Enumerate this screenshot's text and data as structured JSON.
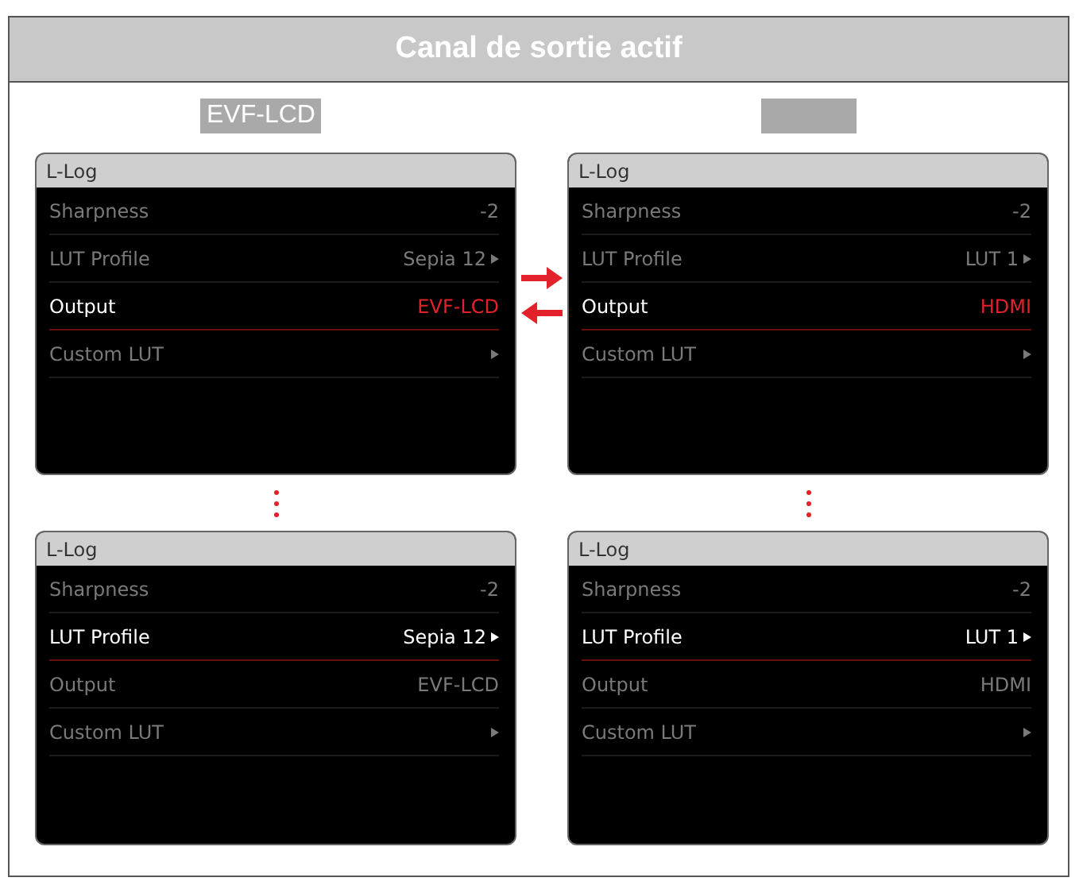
{
  "title": "Canal de sortie actif",
  "columns": [
    {
      "chip": "EVF-LCD",
      "screens": [
        {
          "header": "L-Log",
          "rows": [
            {
              "label": "Sharpness",
              "value": "-2",
              "selected": false,
              "value_highlighted": false
            },
            {
              "label": "LUT Profile",
              "value": "Sepia 12",
              "selected": false,
              "value_highlighted": false,
              "submenu": true
            },
            {
              "label": "Output",
              "value": "EVF-LCD",
              "selected": true,
              "value_highlighted": true
            },
            {
              "label": "Custom LUT",
              "selected": false,
              "submenu": true
            }
          ]
        },
        {
          "header": "L-Log",
          "rows": [
            {
              "label": "Sharpness",
              "value": "-2",
              "selected": false,
              "value_highlighted": false
            },
            {
              "label": "LUT Profile",
              "value": "Sepia 12",
              "selected": true,
              "value_highlighted": false,
              "submenu": true
            },
            {
              "label": "Output",
              "value": "EVF-LCD",
              "selected": false,
              "value_highlighted": false
            },
            {
              "label": "Custom LUT",
              "selected": false,
              "submenu": true
            }
          ]
        }
      ]
    },
    {
      "screens": [
        {
          "header": "L-Log",
          "rows": [
            {
              "label": "Sharpness",
              "value": "-2",
              "selected": false,
              "value_highlighted": false
            },
            {
              "label": "LUT Profile",
              "value": "LUT 1",
              "selected": false,
              "value_highlighted": false,
              "submenu": true
            },
            {
              "label": "Output",
              "value": "HDMI",
              "selected": true,
              "value_highlighted": true
            },
            {
              "label": "Custom LUT",
              "selected": false,
              "submenu": true
            }
          ]
        },
        {
          "header": "L-Log",
          "rows": [
            {
              "label": "Sharpness",
              "value": "-2",
              "selected": false,
              "value_highlighted": false
            },
            {
              "label": "LUT Profile",
              "value": "LUT 1",
              "selected": true,
              "value_highlighted": false,
              "submenu": true
            },
            {
              "label": "Output",
              "value": "HDMI",
              "selected": false,
              "value_highlighted": false
            },
            {
              "label": "Custom LUT",
              "selected": false,
              "submenu": true
            }
          ]
        }
      ]
    }
  ]
}
